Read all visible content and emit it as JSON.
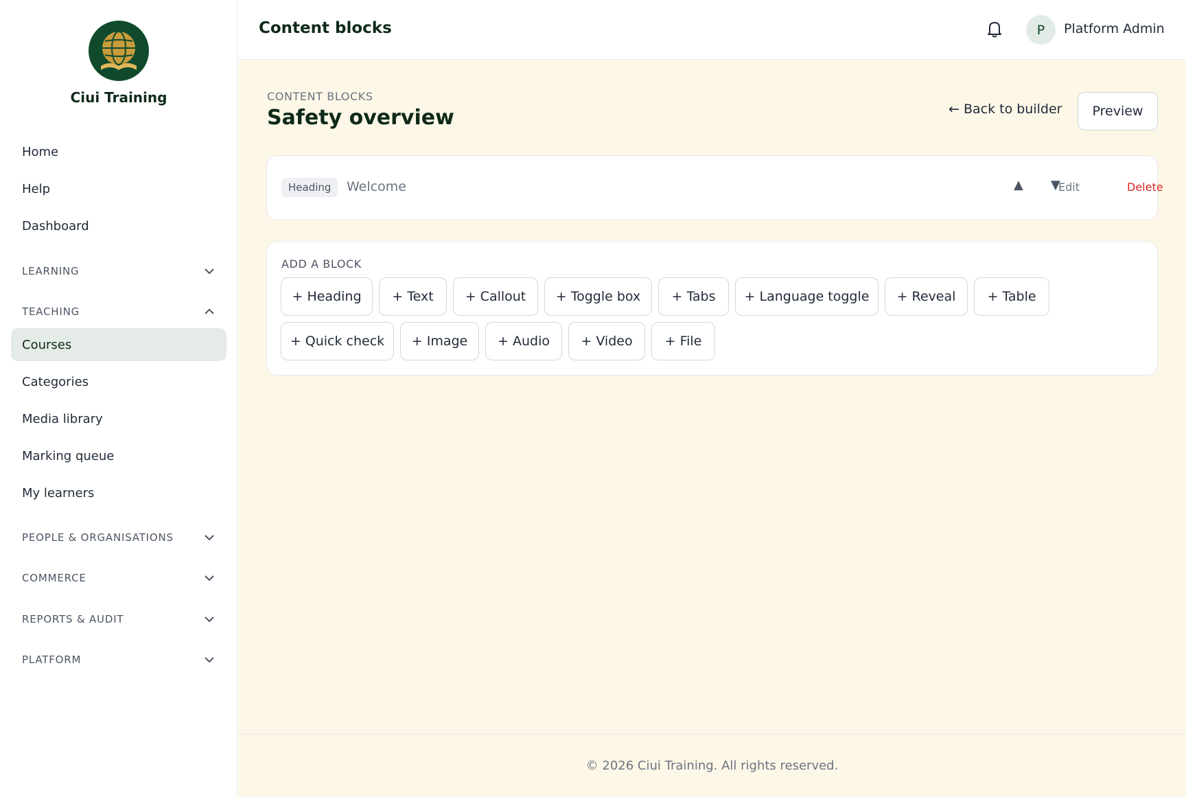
{
  "brand": {
    "name": "Ciui Training",
    "logo_icon": "globe-book-icon"
  },
  "sidebar": {
    "items": [
      {
        "label": "Home"
      },
      {
        "label": "Help"
      },
      {
        "label": "Dashboard"
      }
    ],
    "sections": [
      {
        "label": "LEARNING",
        "expanded": false
      },
      {
        "label": "TEACHING",
        "expanded": true,
        "items": [
          {
            "label": "Courses",
            "active": true
          },
          {
            "label": "Categories"
          },
          {
            "label": "Media library"
          },
          {
            "label": "Marking queue"
          },
          {
            "label": "My learners"
          }
        ]
      },
      {
        "label": "PEOPLE & ORGANISATIONS",
        "expanded": false
      },
      {
        "label": "COMMERCE",
        "expanded": false
      },
      {
        "label": "REPORTS & AUDIT",
        "expanded": false
      },
      {
        "label": "PLATFORM",
        "expanded": false
      }
    ]
  },
  "topbar": {
    "title": "Content blocks",
    "bell_icon": "bell-icon",
    "avatar_initial": "P",
    "user_name": "Platform Admin"
  },
  "main": {
    "eyebrow": "CONTENT BLOCKS",
    "title": "Safety overview",
    "back_label": "← Back to builder",
    "preview_label": "Preview",
    "blocks": [
      {
        "type": "Heading",
        "text": "Welcome",
        "up": "▲",
        "down": "▼",
        "edit": "Edit",
        "delete": "Delete"
      }
    ],
    "add_block": {
      "label": "ADD A BLOCK",
      "buttons": [
        "+ Heading",
        "+ Text",
        "+ Callout",
        "+ Toggle box",
        "+ Tabs",
        "+ Language toggle",
        "+ Reveal",
        "+ Table",
        "+ Quick check",
        "+ Image",
        "+ Audio",
        "+ Video",
        "+ File"
      ]
    }
  },
  "footer": {
    "text": "© 2026 Ciui Training. All rights reserved."
  },
  "colors": {
    "accent_green": "#0f4a2c",
    "active_bg": "#e5ebe7",
    "main_bg": "#fdf7e7",
    "danger": "#dc2626"
  }
}
